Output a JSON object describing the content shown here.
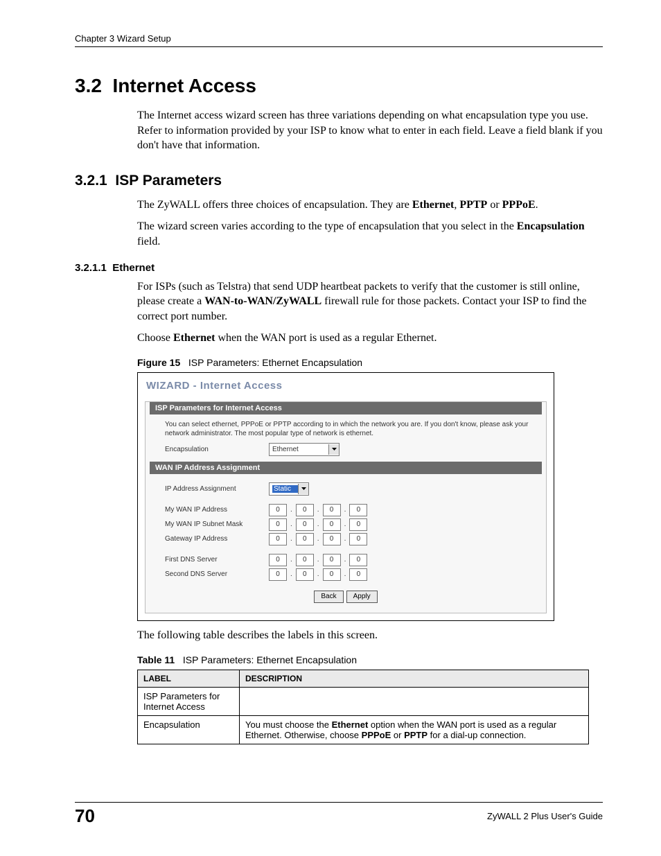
{
  "header": {
    "chapter": "Chapter 3 Wizard Setup"
  },
  "section": {
    "number": "3.2",
    "title": "Internet Access",
    "intro": "The Internet access wizard screen has three variations depending on what encapsulation type you use. Refer to information provided by your ISP to know what to enter in each field. Leave a field blank if you don't have that information."
  },
  "subsection": {
    "number": "3.2.1",
    "title": "ISP Parameters",
    "p1_pre": "The ZyWALL offers three choices of encapsulation. They are ",
    "p1_b1": "Ethernet",
    "p1_mid1": ", ",
    "p1_b2": "PPTP",
    "p1_mid2": " or ",
    "p1_b3": "PPPoE",
    "p1_post": ".",
    "p2_pre": "The wizard screen varies according to the type of encapsulation that you select in the ",
    "p2_b1": "Encapsulation",
    "p2_post": " field."
  },
  "subsub": {
    "number": "3.2.1.1",
    "title": "Ethernet",
    "p1_pre": "For ISPs (such as Telstra) that send UDP heartbeat packets to verify that the customer is still online, please create a ",
    "p1_b1": "WAN-to-WAN/ZyWALL",
    "p1_post": " firewall rule for those packets. Contact your ISP to find the correct port number.",
    "p2_pre": "Choose ",
    "p2_b1": "Ethernet",
    "p2_post": " when the WAN port is used as a regular Ethernet."
  },
  "figure": {
    "label": "Figure 15",
    "caption": "ISP Parameters: Ethernet Encapsulation"
  },
  "wizard": {
    "title": "WIZARD - Internet Access",
    "section1_title": "ISP Parameters for Internet Access",
    "note": "You can select ethernet, PPPoE or PPTP according to in which the network you are. If you don't know, please ask your network administrator. The most popular type of network is ethernet.",
    "encapsulation_label": "Encapsulation",
    "encapsulation_value": "Ethernet",
    "section2_title": "WAN IP Address Assignment",
    "ip_assign_label": "IP Address Assignment",
    "ip_assign_value": "Static",
    "rows": {
      "wan_ip": {
        "label": "My WAN IP Address",
        "v": [
          "0",
          "0",
          "0",
          "0"
        ]
      },
      "subnet": {
        "label": "My WAN IP Subnet Mask",
        "v": [
          "0",
          "0",
          "0",
          "0"
        ]
      },
      "gateway": {
        "label": "Gateway IP Address",
        "v": [
          "0",
          "0",
          "0",
          "0"
        ]
      },
      "dns1": {
        "label": "First DNS Server",
        "v": [
          "0",
          "0",
          "0",
          "0"
        ]
      },
      "dns2": {
        "label": "Second DNS Server",
        "v": [
          "0",
          "0",
          "0",
          "0"
        ]
      }
    },
    "buttons": {
      "back": "Back",
      "apply": "Apply"
    }
  },
  "after_figure_text": "The following table describes the labels in this screen.",
  "table": {
    "label": "Table 11",
    "caption": "ISP Parameters: Ethernet Encapsulation",
    "headers": {
      "label": "LABEL",
      "description": "DESCRIPTION"
    },
    "rows": [
      {
        "label": "ISP Parameters for Internet Access",
        "desc": ""
      },
      {
        "label": "Encapsulation",
        "desc_pre": "You must choose the ",
        "desc_b1": "Ethernet",
        "desc_mid1": " option when the WAN port is used as a regular Ethernet. Otherwise, choose ",
        "desc_b2": "PPPoE",
        "desc_mid2": " or ",
        "desc_b3": "PPTP",
        "desc_post": " for a dial-up connection."
      }
    ]
  },
  "footer": {
    "page_number": "70",
    "guide": "ZyWALL 2 Plus User's Guide"
  }
}
